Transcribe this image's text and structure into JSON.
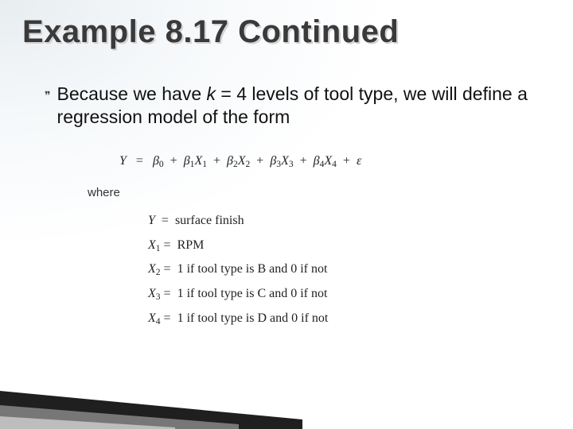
{
  "title": "Example 8.17 Continued",
  "bullet": {
    "prefix": "Because we have ",
    "k_var": "k",
    "eq": " = 4",
    "suffix": " levels of tool type, we will define a regression model of the form"
  },
  "equation": {
    "Y": "Y",
    "eq": "=",
    "b0": "β",
    "b0s": "0",
    "plus": "+",
    "b1": "β",
    "b1s": "1",
    "X1": "X",
    "X1s": "1",
    "b2": "β",
    "b2s": "2",
    "X2": "X",
    "X2s": "2",
    "b3": "β",
    "b3s": "3",
    "X3": "X",
    "X3s": "3",
    "b4": "β",
    "b4s": "4",
    "X4": "X",
    "X4s": "4",
    "eps": "ε"
  },
  "where_label": "where",
  "defs": {
    "d0l": "Y",
    "d0r": "surface finish",
    "d1l": "X",
    "d1s": "1",
    "d1r": "RPM",
    "d2l": "X",
    "d2s": "2",
    "d2r": "1 if tool type is B and 0 if not",
    "d3l": "X",
    "d3s": "3",
    "d3r": "1 if tool type is C and 0 if not",
    "d4l": "X",
    "d4s": "4",
    "d4r": "1 if tool type is D and 0 if not"
  }
}
